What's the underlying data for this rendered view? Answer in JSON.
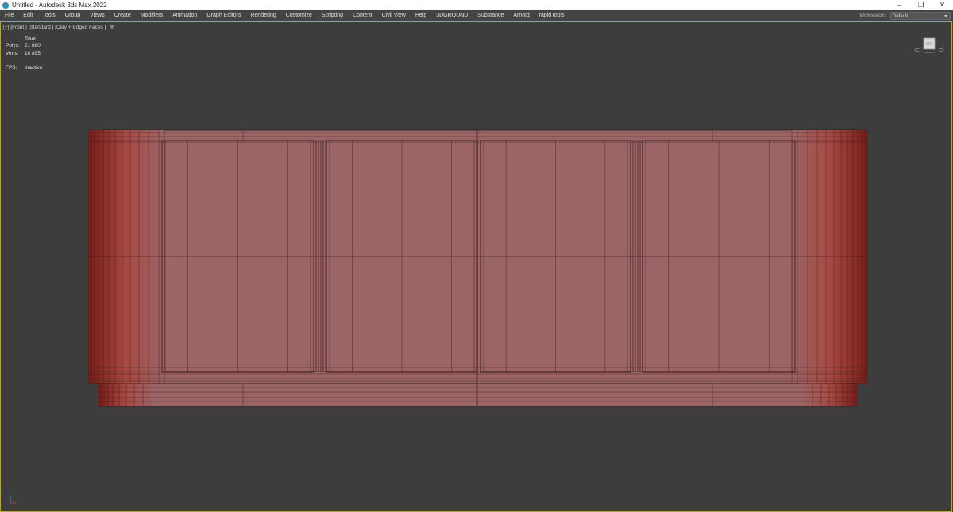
{
  "window": {
    "title": "Untitled - Autodesk 3ds Max 2022",
    "controls": [
      "–",
      "❐",
      "✕"
    ]
  },
  "menu": [
    "File",
    "Edit",
    "Tools",
    "Group",
    "Views",
    "Create",
    "Modifiers",
    "Animation",
    "Graph Editors",
    "Rendering",
    "Customize",
    "Scripting",
    "Content",
    "Civil View",
    "Help",
    "3DGROUND",
    "Substance",
    "Arnold",
    "rapidTools"
  ],
  "workspace": {
    "label": "Workspaces:",
    "value": "Default"
  },
  "viewport": {
    "label": "[+] [Front ] [Standard ] [Clay + Edged Faces ]",
    "stats": {
      "header": "Total",
      "polys_label": "Polys:",
      "polys": "21 680",
      "verts_label": "Verts:",
      "verts": "10 895",
      "fps_label": "FPS:",
      "fps": "Inactive"
    },
    "border_color": "#b8a52e",
    "model_color": "#9b6466",
    "edge_color": "#3a1a1a"
  }
}
